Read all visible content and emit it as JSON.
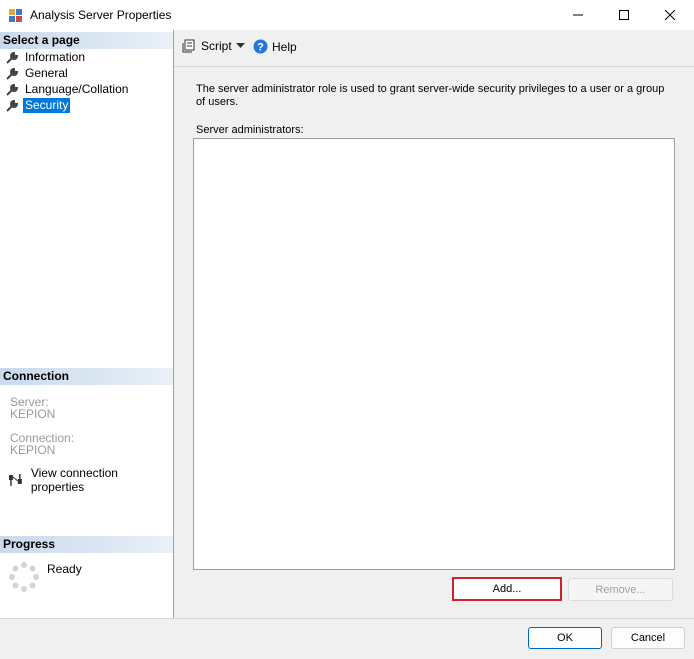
{
  "window": {
    "title": "Analysis Server Properties"
  },
  "select_page": {
    "header": "Select a page",
    "items": [
      {
        "label": "Information"
      },
      {
        "label": "General"
      },
      {
        "label": "Language/Collation"
      },
      {
        "label": "Security",
        "selected": true
      }
    ]
  },
  "connection": {
    "header": "Connection",
    "server_label": "Server:",
    "server_value": "KEPION",
    "connection_label": "Connection:",
    "connection_value": "KEPION",
    "view_link": "View connection properties"
  },
  "progress": {
    "header": "Progress",
    "status": "Ready"
  },
  "toolbar": {
    "script_label": "Script",
    "help_label": "Help"
  },
  "security": {
    "description": "The server administrator role is used to grant server-wide security privileges to a user or a group of users.",
    "list_label": "Server administrators:",
    "administrators": [],
    "add_label": "Add...",
    "remove_label": "Remove..."
  },
  "dialog": {
    "ok_label": "OK",
    "cancel_label": "Cancel"
  },
  "colors": {
    "selection": "#0078d7",
    "highlight_border": "#d0202a",
    "help_icon": "#1e78d7"
  }
}
